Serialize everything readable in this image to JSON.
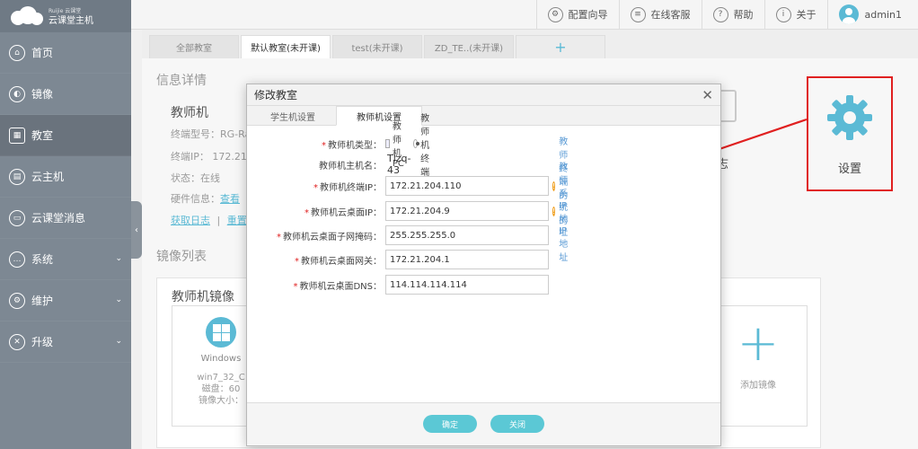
{
  "brand": {
    "name": "云课堂主机",
    "small": "Ruijie 云课堂"
  },
  "sidebar": {
    "items": [
      {
        "label": "首页",
        "icon": "home-icon",
        "glyph": "⌂"
      },
      {
        "label": "镜像",
        "icon": "disc-icon",
        "glyph": "◐"
      },
      {
        "label": "教室",
        "icon": "grid-icon",
        "glyph": "▦"
      },
      {
        "label": "云主机",
        "icon": "server-icon",
        "glyph": "▤"
      },
      {
        "label": "云课堂消息",
        "icon": "message-icon",
        "glyph": "▭"
      },
      {
        "label": "系统",
        "icon": "chat-icon",
        "glyph": "…"
      },
      {
        "label": "维护",
        "icon": "tool-icon",
        "glyph": "⚙"
      },
      {
        "label": "升级",
        "icon": "wrench-icon",
        "glyph": "✕"
      }
    ],
    "caret": "⌄",
    "collapse_glyph": "‹"
  },
  "topbar": {
    "guide": "配置向导",
    "support": "在线客服",
    "help": "帮助",
    "help_glyph": "?",
    "about": "关于",
    "about_glyph": "i",
    "user": "admin1"
  },
  "tabs": [
    {
      "label": "全部教室"
    },
    {
      "label": "默认教室(未开课)"
    },
    {
      "label": "test(未开课)"
    },
    {
      "label": "ZD_TE..(未开课)"
    }
  ],
  "tab_add": "+",
  "background": {
    "info_title": "信息详情",
    "teacher_title": "教师机",
    "model": "终端型号：RG-Ra",
    "ip": "终端IP： 172.21.2",
    "status": "状态：在线",
    "hw_label": "硬件信息：",
    "hw_link": "查看",
    "log_link": "获取日志",
    "separator": "|",
    "restart_link": "重置",
    "mirror_list_title": "镜像列表",
    "teacher_mirror_title": "教师机镜像",
    "card_os": "Windows",
    "card_name": "win7_32_C",
    "card_disk": "磁盘：60",
    "card_size": "镜像大小：",
    "add_mirror": "添加镜像",
    "add_glyph": "+",
    "log_text": "日志",
    "settings_label": "设置"
  },
  "modal": {
    "title": "修改教室",
    "close": "✕",
    "tabs": [
      {
        "label": "学生机设置"
      },
      {
        "label": "教师机设置"
      }
    ],
    "fields": {
      "type_label": "教师机类型：",
      "type_opt_pc": "教师机PC",
      "type_opt_term": "教师机终端",
      "host_label": "教师机主机名：",
      "host_value": "Tlzq-43",
      "term_ip_label": "教师机终端IP：",
      "term_ip_value": "172.21.204.110",
      "term_ip_hint": "教师终端的IP地址",
      "cloud_ip_label": "教师机云桌面IP：",
      "cloud_ip_value": "172.21.204.9",
      "cloud_ip_hint": "教师系统的IP地址",
      "mask_label": "教师机云桌面子网掩码：",
      "mask_value": "255.255.255.0",
      "gw_label": "教师机云桌面网关：",
      "gw_value": "172.21.204.1",
      "dns_label": "教师机云桌面DNS：",
      "dns_value": "114.114.114.114"
    },
    "req_mark": "*",
    "hint_glyph": "!",
    "ok": "确定",
    "close_btn": "关闭"
  },
  "colors": {
    "accent": "#5bbad5",
    "highlight": "#e02020",
    "sidebar": "#7d8893"
  }
}
